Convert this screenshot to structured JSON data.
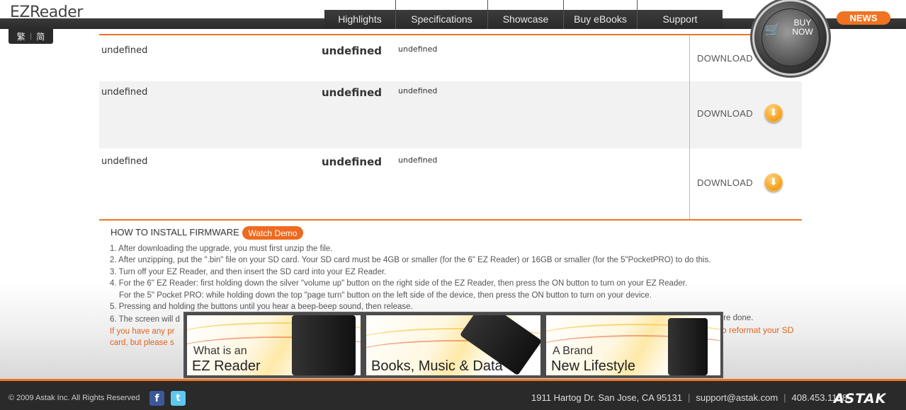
{
  "header": {
    "logo": "EZReader",
    "lang": {
      "traditional": "繁",
      "simplified": "简",
      "separator": "|"
    },
    "nav": [
      "Highlights",
      "Specifications",
      "Showcase",
      "Buy eBooks",
      "Support"
    ],
    "news_label": "NEWS",
    "buy_now": {
      "line1": "BUY",
      "line2": "NOW"
    }
  },
  "downloads": {
    "rows": [
      {
        "col1": "undefined",
        "col2": "undefined",
        "col3": "undefined",
        "action": "DOWNLOAD"
      },
      {
        "col1": "undefined",
        "col2": "undefined",
        "col3": "undefined",
        "action": "DOWNLOAD"
      },
      {
        "col1": "undefined",
        "col2": "undefined",
        "col3": "undefined",
        "action": "DOWNLOAD"
      }
    ]
  },
  "install": {
    "title": "HOW TO INSTALL FIRMWARE",
    "demo_label": "Watch Demo",
    "steps": [
      "1. After downloading the upgrade, you must first unzip the file.",
      "2. After unzipping, put the \".bin\" file on your SD card. Your SD card must be 4GB or smaller (for the 6\" EZ Reader) or 16GB or smaller (for the 5\"PocketPRO) to do this.",
      "3. Turn off your EZ Reader, and then insert the SD card into your EZ Reader.",
      "4. For the 6\" EZ Reader: first holding down the silver \"volume up\" button on the right side of the EZ Reader, then press the ON button to turn on your EZ Reader.",
      "For the 5\" Pocket PRO: while holding down the top \"page turn\" button on the left side of the device, then press the ON button to turn on your device.",
      "5. Pressing and holding the buttons until you hear a beep-beep sound, then release.",
      "6. The screen will d"
    ],
    "orange_line1": "If you have any pr",
    "orange_line2": "card, but please s",
    "tail_done": "'re done.",
    "tail_reformat": "o reformat your SD"
  },
  "banners": [
    {
      "small": "What is an",
      "big": "EZ Reader"
    },
    {
      "small": "",
      "big": "Books, Music & Data"
    },
    {
      "small": "A Brand",
      "big": "New Lifestyle"
    }
  ],
  "footer": {
    "copyright": "© 2009 Astak Inc. All Rights Reserved",
    "facebook": "f",
    "twitter": "t",
    "address": "1911 Hartog Dr. San Jose, CA 95131",
    "email": "support@astak.com",
    "phone": "408.453.1188",
    "separator": "|",
    "brand": "ASTAK"
  },
  "colors": {
    "accent": "#ef7321",
    "dark": "#2a2a2a"
  },
  "icons": [
    "download-arrow-icon",
    "cart-icon",
    "facebook-icon",
    "twitter-icon"
  ]
}
